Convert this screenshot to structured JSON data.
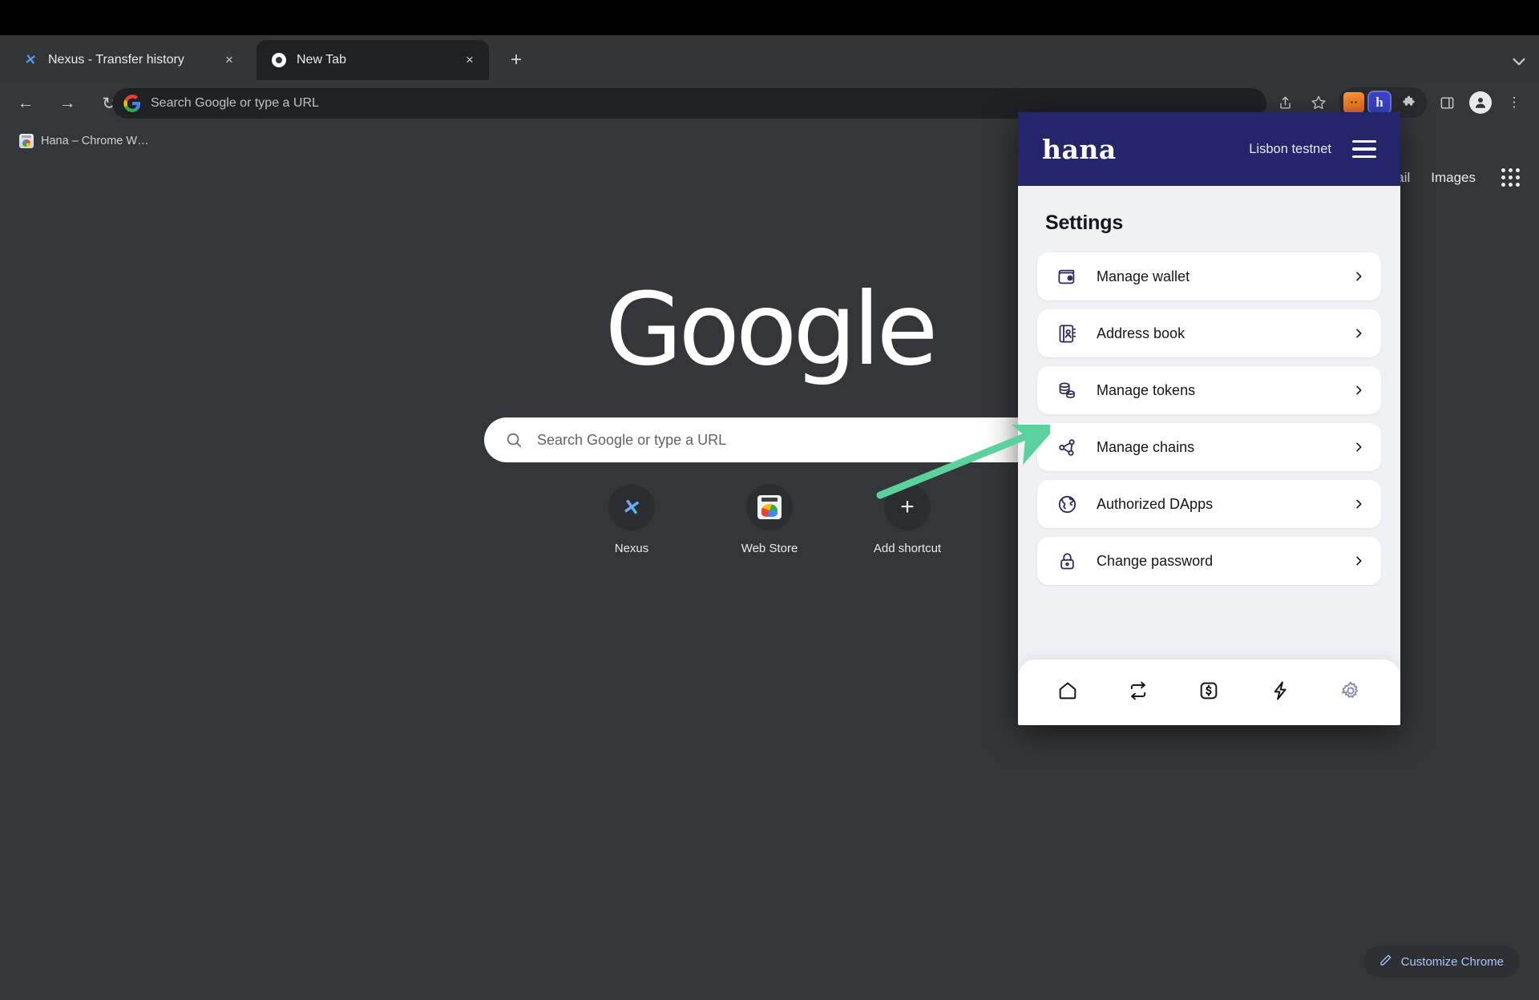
{
  "browser": {
    "tabs": [
      {
        "title": "Nexus - Transfer history",
        "favicon": "nexus-x-icon",
        "active": false,
        "close_label": "×"
      },
      {
        "title": "New Tab",
        "favicon": "chrome-icon",
        "active": true,
        "close_label": "×"
      }
    ],
    "new_tab_label": "+",
    "tab_search_icon": "chevron-down-icon",
    "nav": {
      "back": "←",
      "forward": "→",
      "reload": "↻"
    },
    "omnibox": {
      "placeholder": "Search Google or type a URL",
      "value": "",
      "icon": "google-g-icon"
    },
    "toolbar_icons": {
      "share": "⤴",
      "bookmark_star": "☆",
      "extension_metamask": "🦊",
      "extension_hana": "h",
      "extensions_puzzle": "🧩",
      "side_panel": "▭",
      "profile": "👤",
      "menu": "⋮"
    },
    "bookmarks": [
      {
        "label": "Hana – Chrome W…",
        "icon": "chrome-webstore-icon"
      }
    ]
  },
  "new_tab_page": {
    "google_links": [
      "ail",
      "Images"
    ],
    "apps_grid_icon": "apps-grid-icon",
    "logo_text": "Google",
    "search": {
      "placeholder": "Search Google or type a URL",
      "icon": "search-icon"
    },
    "shortcuts": [
      {
        "label": "Nexus",
        "icon": "nexus-x-icon"
      },
      {
        "label": "Web Store",
        "icon": "chrome-webstore-icon"
      },
      {
        "label": "Add shortcut",
        "icon": "plus-icon"
      }
    ],
    "customize": {
      "label": "Customize Chrome",
      "icon": "pencil-icon"
    }
  },
  "popup": {
    "header": {
      "logo": "hana",
      "network": "Lisbon testnet",
      "menu_icon": "hamburger-menu-icon"
    },
    "title": "Settings",
    "menu_items": [
      {
        "label": "Manage wallet",
        "icon": "wallet-icon",
        "chevron": "chevron-right-icon"
      },
      {
        "label": "Address book",
        "icon": "address-book-icon",
        "chevron": "chevron-right-icon"
      },
      {
        "label": "Manage tokens",
        "icon": "coins-icon",
        "chevron": "chevron-right-icon"
      },
      {
        "label": "Manage chains",
        "icon": "network-nodes-icon",
        "chevron": "chevron-right-icon"
      },
      {
        "label": "Authorized DApps",
        "icon": "globe-icon",
        "chevron": "chevron-right-icon"
      },
      {
        "label": "Change password",
        "icon": "lock-icon",
        "chevron": "chevron-right-icon"
      }
    ],
    "bottom_nav": [
      {
        "name": "home",
        "icon": "home-icon",
        "active": false
      },
      {
        "name": "swap",
        "icon": "swap-icon",
        "active": false
      },
      {
        "name": "buy",
        "icon": "dollar-box-icon",
        "active": false
      },
      {
        "name": "activity",
        "icon": "bolt-icon",
        "active": false
      },
      {
        "name": "settings",
        "icon": "gear-icon",
        "active": true
      }
    ]
  },
  "annotation": {
    "type": "arrow",
    "color": "#5BD19D",
    "points_to": "Manage tokens"
  },
  "colors": {
    "popup_header": "#23266b",
    "popup_body": "#eff1f5",
    "card": "#ffffff",
    "icon_navy": "#282b5c",
    "arrow_green": "#5BD19D",
    "browser_chrome": "#35363a",
    "tabstrip": "#323639",
    "customize_text": "#a8c7fa"
  }
}
